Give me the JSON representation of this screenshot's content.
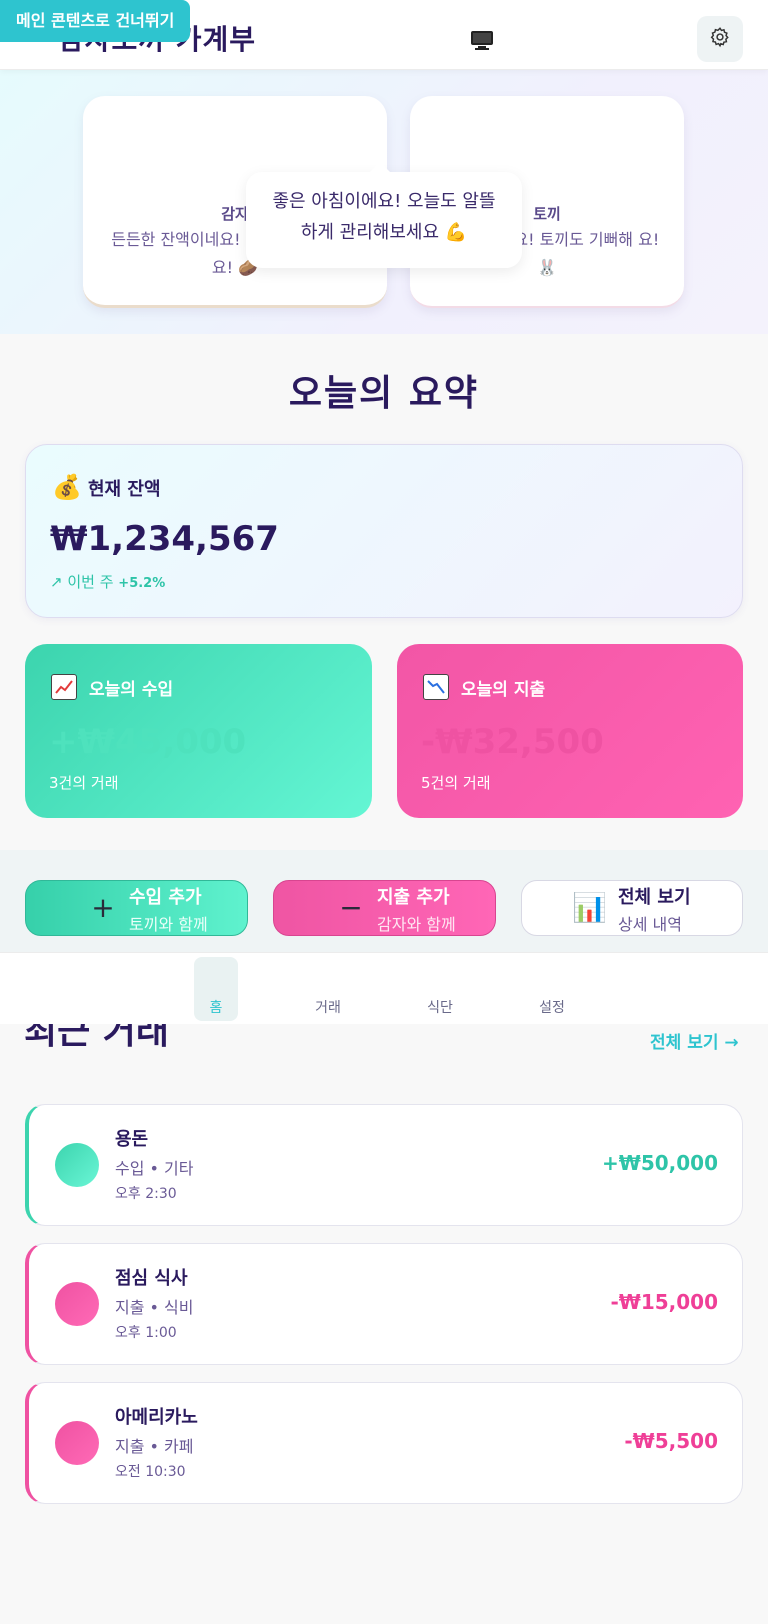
{
  "skip_link": "메인 콘텐츠로 건너뛰기",
  "header": {
    "title": "감자토끼 가계부",
    "monitor_icon": "monitor-icon",
    "settings_icon": "gear-icon"
  },
  "hero": {
    "potato": {
      "name": "감자",
      "message": "든든한 잔액이네요! 감자도 든든해 세요! 🥔"
    },
    "bunny": {
      "name": "토끼",
      "message": "좋은 소비네요! 토끼도 기뻐해 요! 🐰"
    },
    "tooltip": "좋은 아침이에요! 오늘도 알뜰하게 관리해보세요 💪"
  },
  "summary": {
    "title": "오늘의 요약",
    "balance": {
      "icon": "💰",
      "label": "현재 잔액",
      "amount": "₩1,234,567",
      "trend_label": "↗ 이번 주",
      "trend_value": "+5.2%"
    },
    "income": {
      "icon": "📈",
      "label": "오늘의 수입",
      "amount": "+₩45,000",
      "count": "3건의 거래",
      "color": "#3cd4ae"
    },
    "expense": {
      "icon": "📉",
      "label": "오늘의 지출",
      "amount": "-₩32,500",
      "count": "5건의 거래",
      "color": "#ef52a2"
    }
  },
  "quick_actions": {
    "income": {
      "icon": "plus-icon",
      "glyph": "+",
      "title": "수입 추가",
      "sub": "토끼와 함께"
    },
    "expense": {
      "icon": "minus-icon",
      "glyph": "−",
      "title": "지출 추가",
      "sub": "감자와 함께"
    },
    "all": {
      "icon": "bar-chart-icon",
      "glyph": "📊",
      "title": "전체 보기",
      "sub": "상세 내역"
    }
  },
  "nav": {
    "items": [
      {
        "label": "홈",
        "active": true
      },
      {
        "label": "거래",
        "active": false
      },
      {
        "label": "식단",
        "active": false
      },
      {
        "label": "설정",
        "active": false
      }
    ]
  },
  "recent": {
    "title": "최근 거래",
    "see_all": "전체 보기 →",
    "items": [
      {
        "type": "income",
        "name": "용돈",
        "meta": "수입 • 기타",
        "time": "오후 2:30",
        "amount": "+₩50,000"
      },
      {
        "type": "expense",
        "name": "점심 식사",
        "meta": "지출 • 식비",
        "time": "오후 1:00",
        "amount": "-₩15,000"
      },
      {
        "type": "expense",
        "name": "아메리카노",
        "meta": "지출 • 카페",
        "time": "오전 10:30",
        "amount": "-₩5,500"
      }
    ]
  }
}
